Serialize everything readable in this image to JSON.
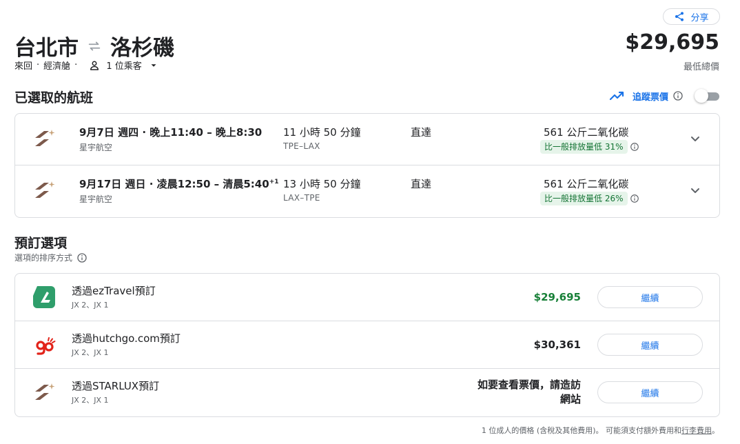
{
  "header": {
    "share_label": "分享",
    "origin": "台北市",
    "destination": "洛杉磯",
    "trip_type": "來回",
    "cabin": "經濟艙",
    "passengers": "1 位乘客",
    "total_price": "$29,695",
    "total_label": "最低總價"
  },
  "selected": {
    "title": "已選取的航班",
    "track_label": "追蹤票價",
    "flights": [
      {
        "times": "9月7日 週四 · 晚上11:40 – 晚上8:30",
        "day_offset": "",
        "airline": "星宇航空",
        "duration": "11 小時 50 分鐘",
        "route": "TPE–LAX",
        "stops": "直達",
        "co2": "561 公斤二氧化碳",
        "emission_badge": "比一般排放量低 31%"
      },
      {
        "times": "9月17日 週日 · 凌晨12:50 – 清晨5:40",
        "day_offset": "+1",
        "airline": "星宇航空",
        "duration": "13 小時 50 分鐘",
        "route": "LAX–TPE",
        "stops": "直達",
        "co2": "561 公斤二氧化碳",
        "emission_badge": "比一般排放量低 26%"
      }
    ]
  },
  "booking": {
    "title": "預訂選項",
    "sort_label": "選項的排序方式",
    "options": [
      {
        "title": "透過ezTravel預訂",
        "flights": "JX 2、JX 1",
        "price": "$29,695",
        "visit_text_1": "",
        "visit_text_2": "",
        "button": "繼續",
        "logo": "eztravel-logo"
      },
      {
        "title": "透過hutchgo.com預訂",
        "flights": "JX 2、JX 1",
        "price": "$30,361",
        "visit_text_1": "",
        "visit_text_2": "",
        "button": "繼續",
        "logo": "hutchgo-logo"
      },
      {
        "title": "透過STARLUX預訂",
        "flights": "JX 2、JX 1",
        "price": "",
        "visit_text_1": "如要查看票價，請造訪",
        "visit_text_2": "網站",
        "button": "繼續",
        "logo": "starlux-logo"
      }
    ]
  },
  "footer": {
    "note": "1 位成人的價格 (含稅及其他費用)。 可能須支付額外費用和",
    "link": "行李費用",
    "end": "。"
  },
  "colors": {
    "accent": "#1a73e8",
    "price_green": "#188038",
    "badge_bg": "#e6f4ea",
    "badge_text": "#137333",
    "starlux_brown": "#7d5a4c",
    "starlux_gold": "#c8a37a",
    "eztravel_green": "#2f9e6b",
    "hutchgo_red": "#e2231a"
  }
}
